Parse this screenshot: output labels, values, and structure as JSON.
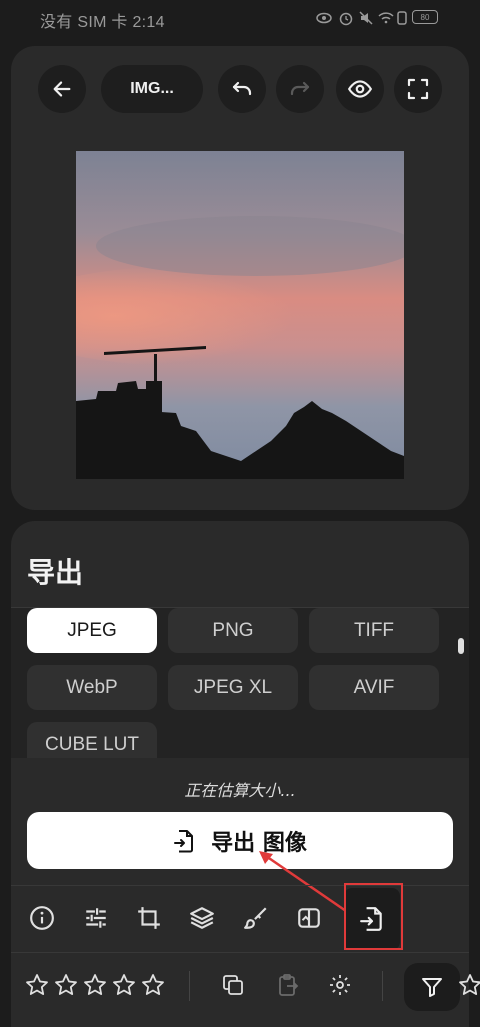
{
  "status_bar": {
    "text": "没有 SIM 卡 2:14",
    "battery": "80"
  },
  "toolbar": {
    "title": "IMG...",
    "icons": [
      "back-arrow-icon",
      "undo-icon",
      "redo-icon",
      "eye-icon",
      "fullscreen-icon"
    ]
  },
  "export": {
    "title": "导出",
    "formats": [
      "JPEG",
      "PNG",
      "TIFF",
      "WebP",
      "JPEG XL",
      "AVIF",
      "CUBE LUT"
    ],
    "selected_format": "JPEG",
    "estimate_text": "正在估算大小...",
    "export_button_label": "导出 图像"
  },
  "tools": [
    "info-icon",
    "adjust-sliders-icon",
    "crop-icon",
    "layers-icon",
    "brush-icon",
    "tag-icon",
    "export-file-icon"
  ],
  "rating_stars": 5,
  "colors": {
    "panel": "#2a2a2a",
    "background": "#1c1c1c",
    "highlight": "#e03a3a",
    "selected": "#ffffff"
  }
}
